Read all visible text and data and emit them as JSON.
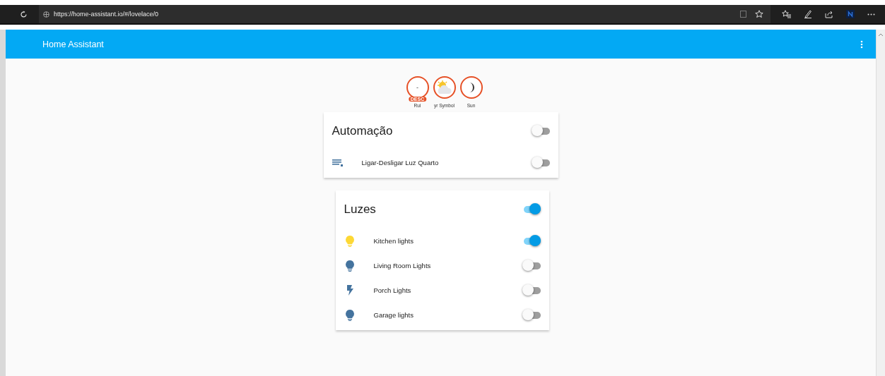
{
  "browser": {
    "url": "https://home-assistant.io/#/lovelace/0"
  },
  "header": {
    "title": "Home Assistant"
  },
  "badges": [
    {
      "kind": "text",
      "value": "-",
      "tag": "DESC",
      "name": "Rui"
    },
    {
      "kind": "weather",
      "name": "yr Symbol"
    },
    {
      "kind": "moon",
      "name": "Sun"
    }
  ],
  "cards": [
    {
      "title": "Automação",
      "on": false,
      "entities": [
        {
          "kind": "list",
          "name": "Ligar-Desligar Luz Quarto",
          "on": false
        }
      ]
    },
    {
      "title": "Luzes",
      "on": true,
      "entities": [
        {
          "kind": "bulb",
          "name": "Kitchen lights",
          "on": true
        },
        {
          "kind": "bulb",
          "name": "Living Room Lights",
          "on": false
        },
        {
          "kind": "flash",
          "name": "Porch Lights",
          "on": false
        },
        {
          "kind": "bulb",
          "name": "Garage lights",
          "on": false
        }
      ]
    }
  ]
}
